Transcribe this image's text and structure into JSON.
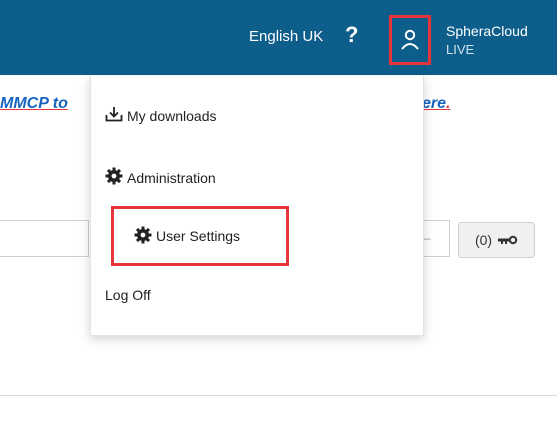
{
  "header": {
    "language": "English UK",
    "help_symbol": "?",
    "app_name": "SpheraCloud",
    "environment": "LIVE",
    "user_icon": "user-icon"
  },
  "banner": {
    "left_text": "MMCP to",
    "right_text": "ere",
    "right_dot": "."
  },
  "menu": {
    "items": [
      {
        "label": "My downloads",
        "icon": "download-icon"
      },
      {
        "label": "Administration",
        "icon": "gear-icon"
      },
      {
        "label": "User Settings",
        "icon": "gear-icon"
      },
      {
        "label": "Log Off",
        "icon": ""
      }
    ]
  },
  "cart": {
    "count_label": "(0)",
    "icon": "key-icon"
  },
  "colors": {
    "header_bg": "#0e5e8c",
    "highlight": "#e6353b",
    "link": "#1565c0"
  }
}
